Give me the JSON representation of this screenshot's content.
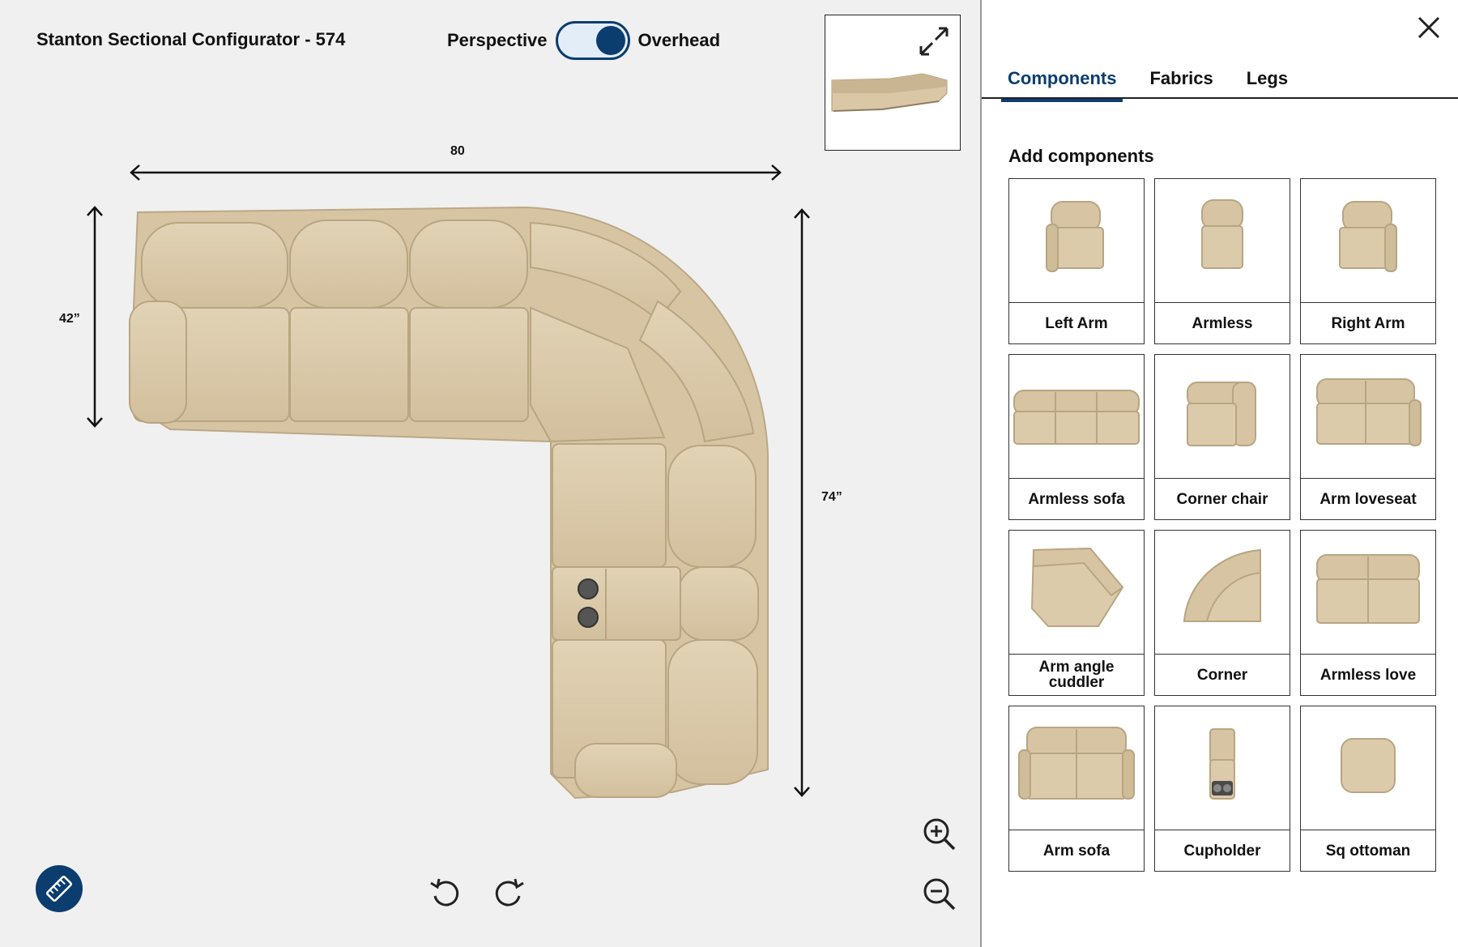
{
  "header": {
    "title": "Stanton Sectional Configurator - 574",
    "view_left_label": "Perspective",
    "view_right_label": "Overhead",
    "view_selected": "Overhead"
  },
  "dimensions": {
    "width": "80",
    "left_depth": "42”",
    "right_depth": "74”"
  },
  "colors": {
    "accent": "#0b3d6e",
    "fabric": "#d9c7a6",
    "fabric_shadow": "#bba886"
  },
  "icons": {
    "expand": "expand-arrows-icon",
    "rotate_left": "rotate-ccw-icon",
    "rotate_right": "rotate-cw-icon",
    "zoom_in": "zoom-in-icon",
    "zoom_out": "zoom-out-icon",
    "measure": "ruler-icon",
    "close": "close-icon"
  },
  "sidebar": {
    "tabs": [
      {
        "label": "Components",
        "active": true
      },
      {
        "label": "Fabrics",
        "active": false
      },
      {
        "label": "Legs",
        "active": false
      }
    ],
    "section_title": "Add components",
    "components": [
      {
        "label": "Left Arm"
      },
      {
        "label": "Armless"
      },
      {
        "label": "Right Arm"
      },
      {
        "label": "Armless sofa"
      },
      {
        "label": "Corner chair"
      },
      {
        "label": "Arm loveseat"
      },
      {
        "label": "Arm angle cuddler"
      },
      {
        "label": "Corner"
      },
      {
        "label": "Armless love"
      },
      {
        "label": "Arm sofa"
      },
      {
        "label": "Cupholder"
      },
      {
        "label": "Sq ottoman"
      }
    ]
  }
}
